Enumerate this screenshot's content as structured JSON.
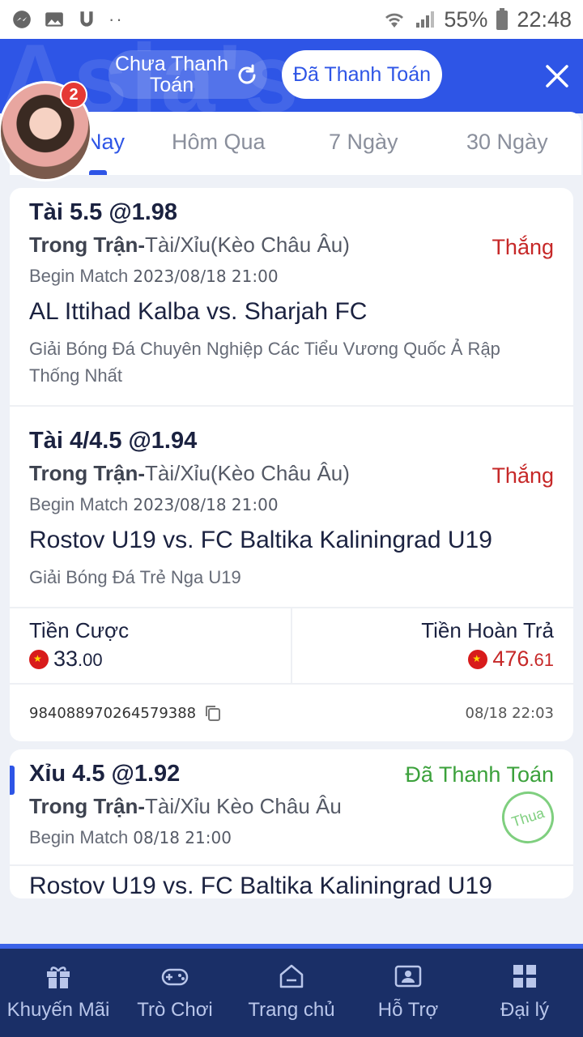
{
  "status_bar": {
    "battery": "55%",
    "time": "22:48"
  },
  "header": {
    "unpaid_label": "Chưa Thanh Toán",
    "paid_label": "Đã Thanh Toán",
    "watermark": "Asia's No.1",
    "avatar_badge": "2"
  },
  "tabs": [
    {
      "label": "Nay"
    },
    {
      "label": "Hôm Qua"
    },
    {
      "label": "7 Ngày"
    },
    {
      "label": "30 Ngày"
    }
  ],
  "card1": {
    "bets": [
      {
        "title": "Tài 5.5 @1.98",
        "type_prefix": "Trong Trận-",
        "type": "Tài/Xỉu(Kèo Châu Âu)",
        "result": "Thắng",
        "begin_label": "Begin Match",
        "begin_time": "2023/08/18 21:00",
        "match": "AL Ittihad Kalba vs. Sharjah FC",
        "league": "Giải Bóng Đá Chuyên Nghiệp Các Tiểu Vương Quốc Ả Rập Thống Nhất"
      },
      {
        "title": "Tài 4/4.5 @1.94",
        "type_prefix": "Trong Trận-",
        "type": "Tài/Xỉu(Kèo Châu Âu)",
        "result": "Thắng",
        "begin_label": "Begin Match",
        "begin_time": "2023/08/18 21:00",
        "match": "Rostov U19 vs. FC Baltika Kaliningrad U19",
        "league": "Giải Bóng Đá Trẻ Nga U19"
      }
    ],
    "stake_label": "Tiền Cược",
    "stake_int": "33",
    "stake_dec": ".00",
    "payout_label": "Tiền Hoàn Trả",
    "payout_int": "476",
    "payout_dec": ".61",
    "ticket_id": "984088970264579388",
    "ticket_time": "08/18 22:03"
  },
  "card2": {
    "title": "Xỉu 4.5 @1.92",
    "status": "Đã Thanh Toán",
    "type_prefix": "Trong Trận-",
    "type": "Tài/Xỉu Kèo Châu Âu",
    "stamp": "Thua",
    "begin_label": "Begin Match",
    "begin_time": "08/18 21:00",
    "match": "Rostov U19 vs. FC Baltika Kaliningrad U19"
  },
  "nav": [
    {
      "label": "Khuyến Mãi",
      "icon": "gift-icon"
    },
    {
      "label": "Trò Chơi",
      "icon": "gamepad-icon"
    },
    {
      "label": "Trang chủ",
      "icon": "home-icon"
    },
    {
      "label": "Hỗ Trợ",
      "icon": "support-icon"
    },
    {
      "label": "Đại lý",
      "icon": "agent-icon"
    }
  ],
  "colors": {
    "primary": "#2e55e6",
    "nav_bg": "#1a2f67",
    "win": "#c62828",
    "paid": "#3ba13b"
  }
}
